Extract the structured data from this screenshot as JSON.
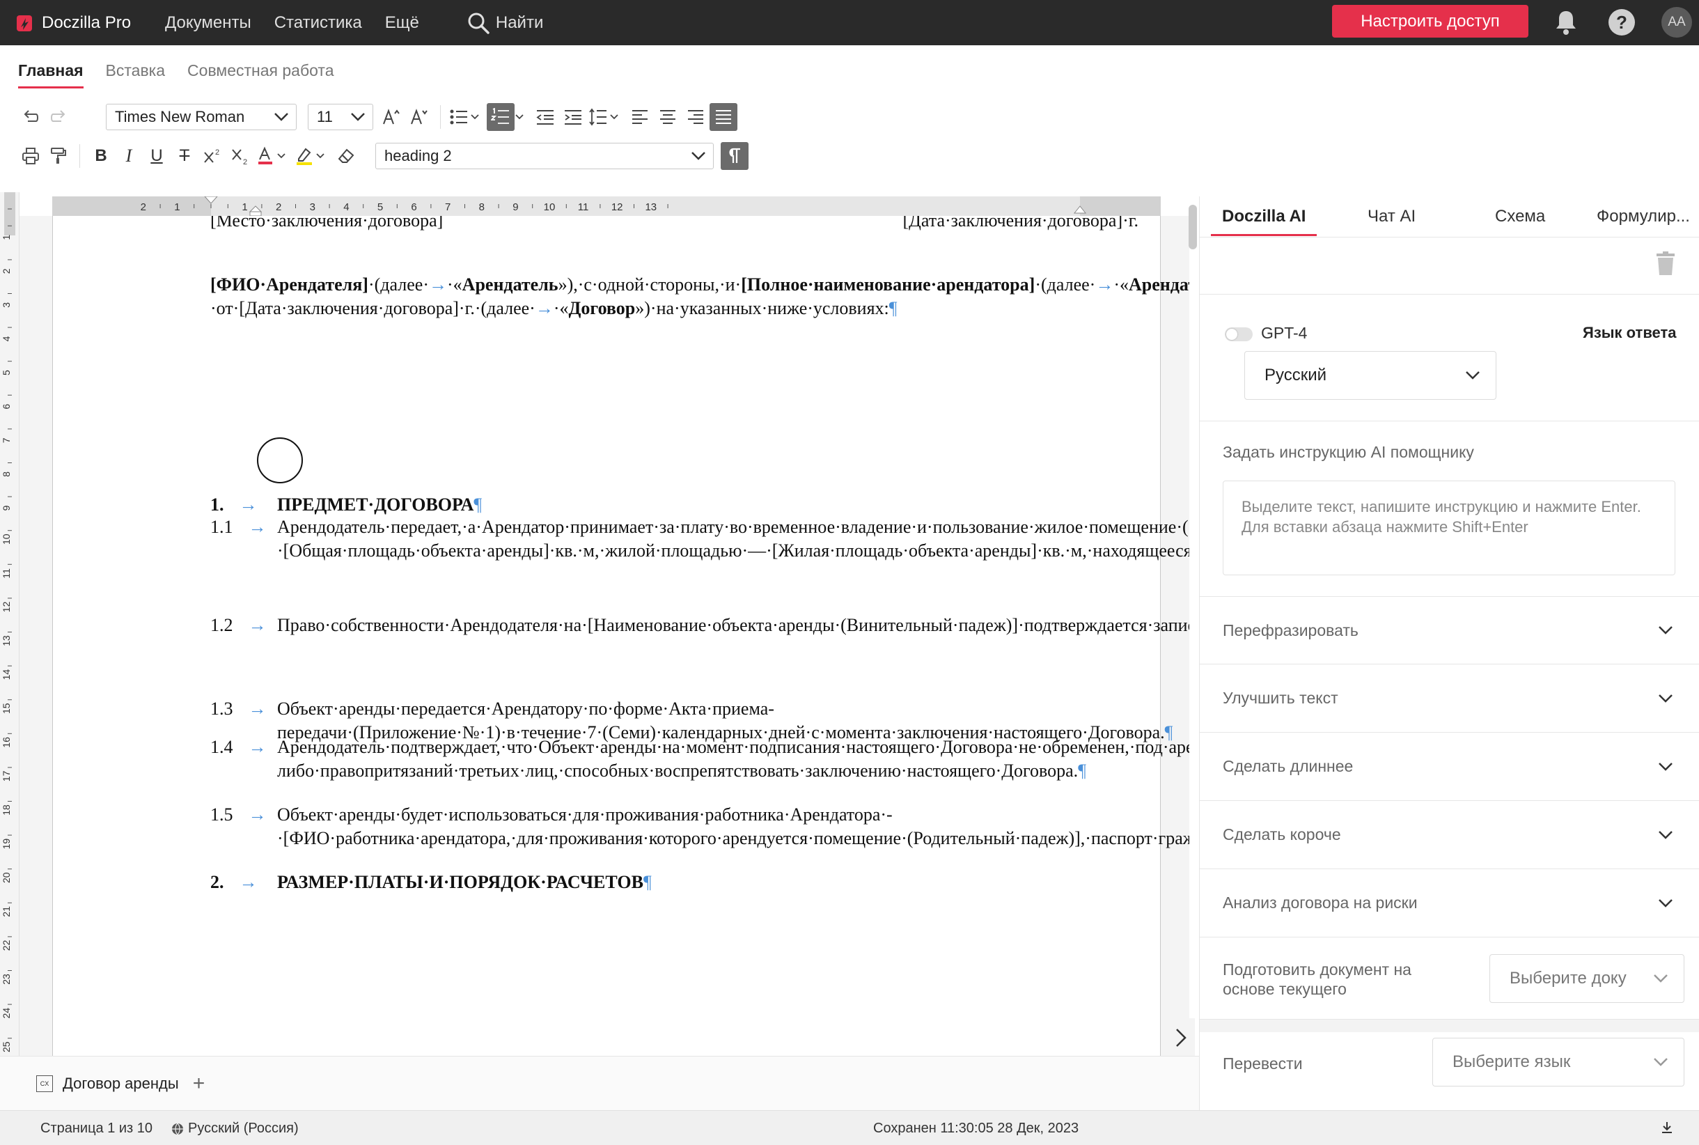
{
  "app": {
    "name": "Doczilla Pro",
    "nav": [
      "Документы",
      "Статистика",
      "Ещё"
    ],
    "search_label": "Найти",
    "access_button": "Настроить доступ",
    "avatar_initials": "AA",
    "brand_color": "#e5304b"
  },
  "ribbon": {
    "tabs": [
      "Главная",
      "Вставка",
      "Совместная работа"
    ],
    "font_family": "Times New Roman",
    "font_size": "11",
    "paragraph_style": "heading 2"
  },
  "document": {
    "top_left": "[Место·заключения·договора]",
    "top_right": "[Дата·заключения·договора]·г.",
    "intro_html": "<b>[ФИО·Арендателя]</b>·(далее·<span class='arrow'>→</span>·«<b>Арендатель</b>»),·с·одной·стороны,·и·<b>[Полное·наименование·арендатора]</b>·(далее·<span class='arrow'>→</span>·«<b>Арендатор</b>»),·в·лице·[Должность·руководителя·арендатора·(Родительный·падеж)]·[ФИО·руководителя·арендатора·(Родительный·падеж)],·действующего·на·основании·Устава,·с·другой·стороны,·далее·совместно·именуемые·<b>«Стороны»</b>,·а·по·отдельности·<b>«Сторона»</b>,·заключили·настоящий·Договор·аренды·[Наименование·объекта·аренды·2·(Родительный·падеж)]·{Наименование·объекта·аренды}·от·[Дата·заключения·договора]·г.·(далее·<span class='arrow'>→</span>·«<b>Договор</b>»)·на·указанных·ниже·условиях:<span class='arrow'>¶</span>",
    "section1_num": "1.",
    "section1_title": "ПРЕДМЕТ·ДОГОВОРА",
    "items": [
      {
        "num": "1.1",
        "html": "Арендодатель·передает,·а·Арендатор·принимает·за·плату·во·временное·владение·и·пользование·жилое·помещение·([Наименование·объекта·аренды·2]·{Наименование·объекта·аренды})·с·кадастровым·номером·[Кадастровый·номер·объекта·аренды],·общей·площадью·-·[Общая·площадь·объекта·аренды]·кв.·м,·жилой·площадью·—·[Жилая·площадь·объекта·аренды]·кв.·м,·находящееся·по·адресу:·[Адрес·объекта·аренды],·состоящее·из·_·комнат·(далее·-·«<b>[Наименование·объекта·аренды]</b>»·или·«<b>Объект·аренды</b>»).<span class='arrow'>¶</span>"
      },
      {
        "num": "1.2",
        "html": "Право·собственности·Арендодателя·на·[Наименование·объекта·аренды·(Винительный·падеж)]·подтверждается·записью·в·Едином·государственном·реестре·недвижимости·от·[Дата·внесения·записи·в·ЕГРН·о·праве·собственности]·года·№·[Номер·записи·в·ЕГРН·о·праве·собственности]·(Выписка·из·Единого·государственного·реестра·недвижимости·Приложение·№·3·к·Договору).<span class='arrow'>¶</span>"
      },
      {
        "num": "1.3",
        "html": "Объект·аренды·передается·Арендатору·по·форме·Акта·приема-передачи·(Приложение·№·1)·в·течение·7·(Семи)·календарных·дней·с·момента·заключения·настоящего·Договора.<span class='arrow'>¶</span>"
      },
      {
        "num": "1.4",
        "html": "Арендодатель·подтверждает,·что·Объект·аренды·на·момент·подписания·настоящего·Договора·не·обременен,·под·арестом·и·запрещением·не·состоит,·свободен·от·каких-либо·правопритязаний·третьих·лиц,·способных·воспрепятствовать·заключению·настоящего·Договора.<span class='arrow'>¶</span>"
      },
      {
        "num": "1.5",
        "html": "Объект·аренды·будет·использоваться·для·проживания·работника·Арендатора·-·[ФИО·работника·арендатора,·для·проживания·которого·арендуется·помещение·(Родительный·падеж)],·паспорт·гражданина·__,·серии___·номер____,·выдан______·от·__.__.____·г.,·код·подразделения_____,·адрес·регистрации:__________________.<span class='arrow'>¶</span>"
      }
    ],
    "section2_num": "2.",
    "section2_title": "РАЗМЕР·ПЛАТЫ·И·ПОРЯДОК·РАСЧЕТОВ"
  },
  "ai_panel": {
    "tabs": [
      "Doczilla AI",
      "Чат AI",
      "Схема",
      "Формулир..."
    ],
    "model_label": "GPT-4",
    "response_lang_label": "Язык ответа",
    "response_lang_value": "Русский",
    "instruction_label": "Задать инструкцию AI помощнику",
    "instruction_placeholder": "Выделите текст, напишите инструкцию и нажмите Enter. Для вставки абзаца нажмите Shift+Enter",
    "actions": [
      "Перефразировать",
      "Улучшить текст",
      "Сделать длиннее",
      "Сделать короче",
      "Анализ договора на риски"
    ],
    "prepare_label": "Подготовить документ на основе текущего",
    "prepare_select": "Выберите доку",
    "translate_label": "Перевести",
    "translate_select": "Выберите язык"
  },
  "tabs_bar": {
    "doc_tab_icon": "CX",
    "doc_tab": "Договор аренды"
  },
  "status": {
    "page": "Страница 1 из 10",
    "language": "Русский (Россия)",
    "saved": "Сохранен 11:30:05 28 Дек, 2023"
  }
}
